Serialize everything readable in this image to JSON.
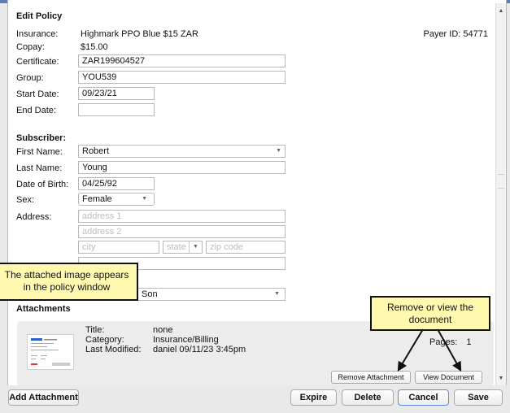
{
  "dialog": {
    "title": "Edit Policy",
    "payer_id_label": "Payer ID:",
    "payer_id": "54771"
  },
  "policy": {
    "insurance_label": "Insurance:",
    "insurance_value": "Highmark PPO Blue $15 ZAR",
    "copay_label": "Copay:",
    "copay_value": "$15.00",
    "certificate_label": "Certificate:",
    "certificate_value": "ZAR199604527",
    "group_label": "Group:",
    "group_value": "YOU539",
    "start_date_label": "Start Date:",
    "start_date_value": "09/23/21",
    "end_date_label": "End Date:",
    "end_date_value": ""
  },
  "subscriber": {
    "heading": "Subscriber:",
    "first_name_label": "First Name:",
    "first_name_value": "Robert",
    "last_name_label": "Last Name:",
    "last_name_value": "Young",
    "dob_label": "Date of Birth:",
    "dob_value": "04/25/92",
    "sex_label": "Sex:",
    "sex_value": "Female",
    "address_label": "Address:",
    "address1_placeholder": "address 1",
    "address2_placeholder": "address 2",
    "city_placeholder": "city",
    "state_placeholder": "state",
    "zip_placeholder": "zip code",
    "relationship_value": "Son"
  },
  "attachments": {
    "heading": "Attachments",
    "title_label": "Title:",
    "title_value": "none",
    "category_label": "Category:",
    "category_value": "Insurance/Billing",
    "modified_label": "Last Modified:",
    "modified_value": "daniel 09/11/23 3:45pm",
    "pages_label": "Pages:",
    "pages_value": "1",
    "remove_label": "Remove Attachment",
    "view_label": "View Document"
  },
  "footer": {
    "add_attachment": "Add Attachment",
    "expire": "Expire",
    "delete": "Delete",
    "cancel": "Cancel",
    "save": "Save"
  },
  "callouts": {
    "left_text": "The attached image appears in the policy window",
    "right_text": "Remove or view the document"
  },
  "colors": {
    "callout_bg": "#fff9b0",
    "panel_bg": "#ececec",
    "window_accent": "#5b7fb0"
  }
}
